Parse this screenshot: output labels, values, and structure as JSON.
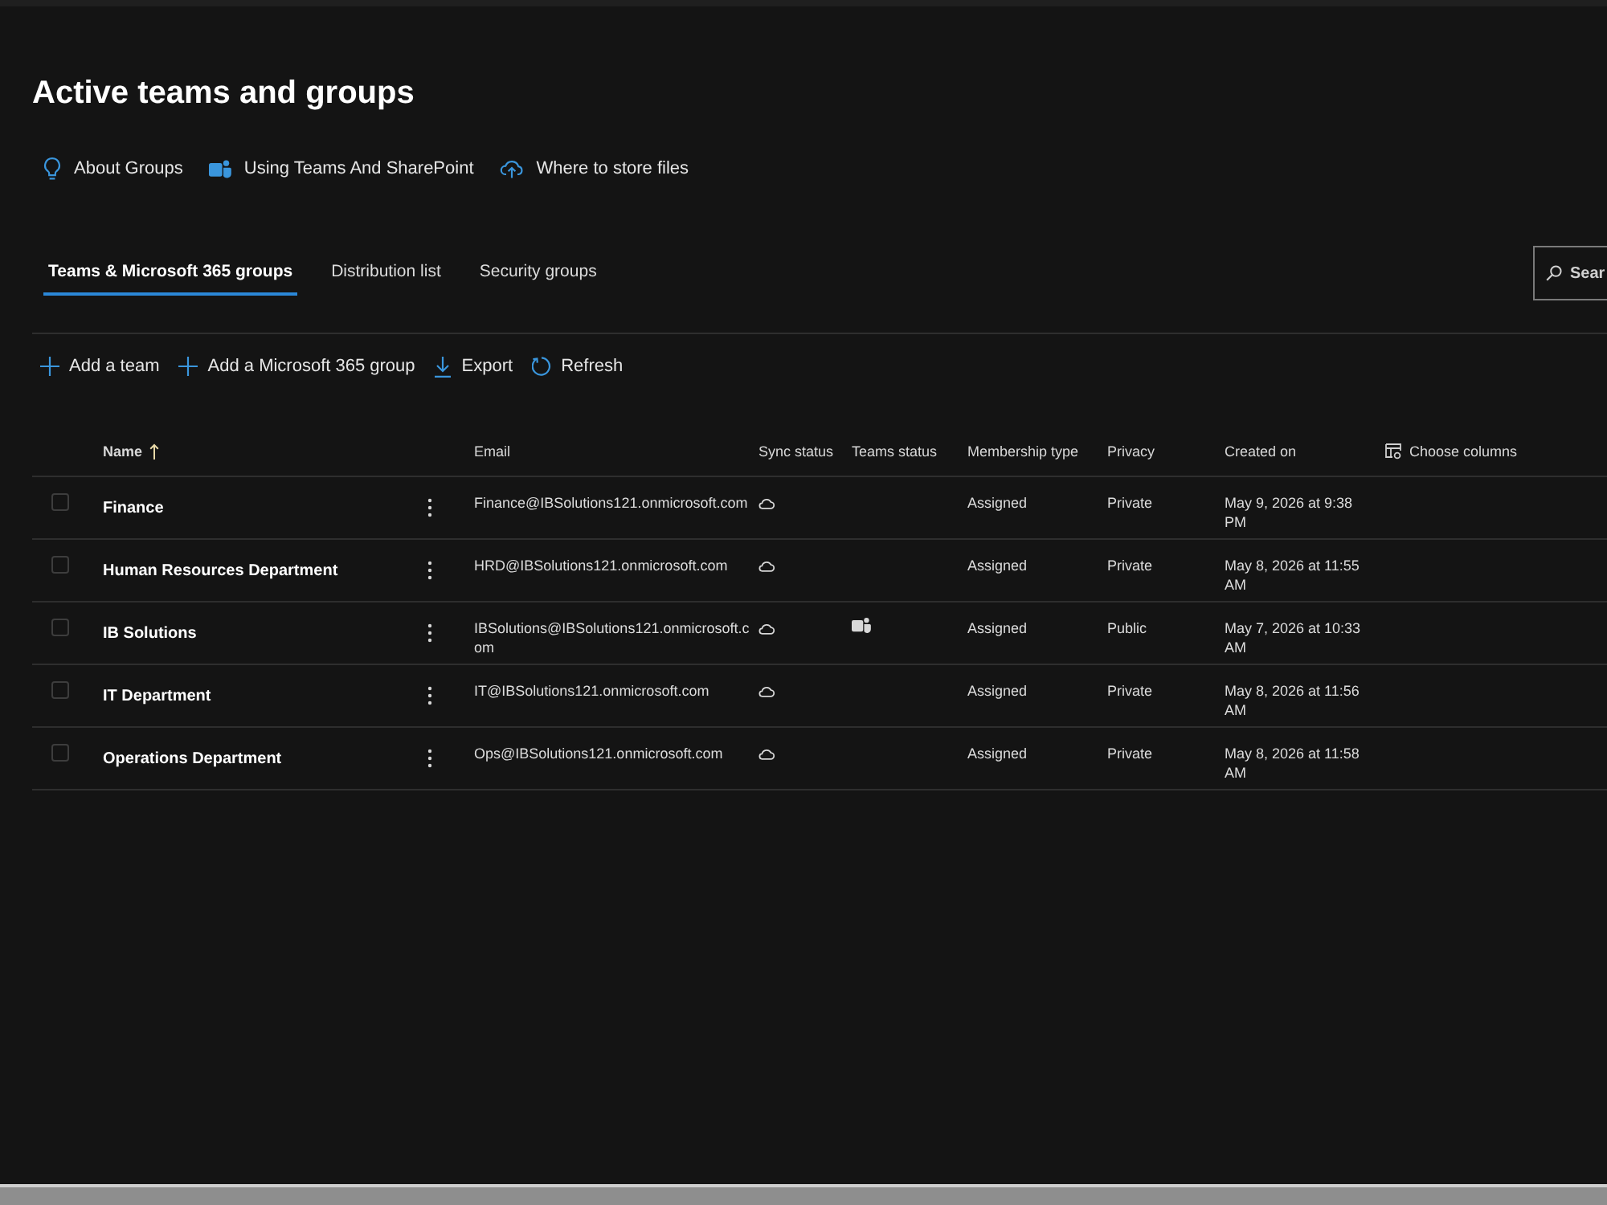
{
  "page": {
    "title": "Active teams and groups"
  },
  "help_links": [
    {
      "label": "About Groups"
    },
    {
      "label": "Using Teams And SharePoint"
    },
    {
      "label": "Where to store files"
    }
  ],
  "tabs": [
    {
      "label": "Teams & Microsoft 365 groups",
      "selected": true
    },
    {
      "label": "Distribution list",
      "selected": false
    },
    {
      "label": "Security groups",
      "selected": false
    }
  ],
  "search": {
    "placeholder": "Sear"
  },
  "toolbar": [
    {
      "label": "Add a team",
      "kind": "add"
    },
    {
      "label": "Add a Microsoft 365 group",
      "kind": "add"
    },
    {
      "label": "Export",
      "kind": "export"
    },
    {
      "label": "Refresh",
      "kind": "refresh"
    }
  ],
  "table": {
    "columns": [
      {
        "label": "Name",
        "sorted": true
      },
      {
        "label": "Email",
        "sorted": false
      },
      {
        "label": "Sync status",
        "sorted": false
      },
      {
        "label": "Teams status",
        "sorted": false
      },
      {
        "label": "Membership type",
        "sorted": false
      },
      {
        "label": "Privacy",
        "sorted": false
      },
      {
        "label": "Created on",
        "sorted": false
      }
    ],
    "choose_columns": "Choose columns",
    "rows": [
      {
        "checked": false,
        "name": "Finance",
        "email": "Finance@IBSolutions121.onmicrosoft.com",
        "synced": true,
        "teams": false,
        "membership_type": "Assigned",
        "privacy": "Private",
        "created_on": "May 9, 2026 at 9:38 PM"
      },
      {
        "checked": false,
        "name": "Human Resources Department",
        "email": "HRD@IBSolutions121.onmicrosoft.com",
        "synced": true,
        "teams": false,
        "membership_type": "Assigned",
        "privacy": "Private",
        "created_on": "May 8, 2026 at 11:55 AM"
      },
      {
        "checked": false,
        "name": "IB Solutions",
        "email": "IBSolutions@IBSolutions121.onmicrosoft.com",
        "synced": true,
        "teams": true,
        "membership_type": "Assigned",
        "privacy": "Public",
        "created_on": "May 7, 2026 at 10:33 AM"
      },
      {
        "checked": false,
        "name": "IT Department",
        "email": "IT@IBSolutions121.onmicrosoft.com",
        "synced": true,
        "teams": false,
        "membership_type": "Assigned",
        "privacy": "Private",
        "created_on": "May 8, 2026 at 11:56 AM"
      },
      {
        "checked": false,
        "name": "Operations Department",
        "email": "Ops@IBSolutions121.onmicrosoft.com",
        "synced": true,
        "teams": false,
        "membership_type": "Assigned",
        "privacy": "Private",
        "created_on": "May 8, 2026 at 11:58 AM"
      }
    ]
  }
}
